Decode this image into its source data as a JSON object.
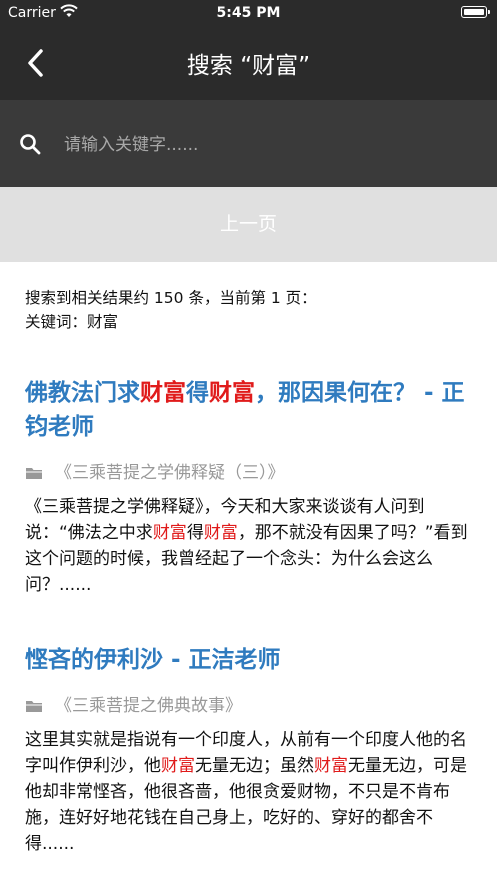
{
  "status": {
    "carrier": "Carrier",
    "time": "5:45 PM"
  },
  "nav": {
    "title": "搜索 “财富”"
  },
  "search": {
    "placeholder": "请输入关键字......"
  },
  "pager": {
    "prev_label": "上一页"
  },
  "summary": {
    "line1": "搜索到相关结果约 150 条，当前第 1 页：",
    "line2": "关键词：财富"
  },
  "keyword": "财富",
  "colors": {
    "accent": "#2f7bbf",
    "highlight": "#e01b1b",
    "bar": "#2b2b2b"
  },
  "results": [
    {
      "title_parts": [
        "佛教法门求",
        "财富",
        "得",
        "财富",
        "，那因果何在？ - 正钧老师"
      ],
      "source": "《三乘菩提之学佛释疑（三）》",
      "snippet_parts": [
        "《三乘菩提之学佛释疑》，今天和大家来谈谈有人问到说：“佛法之中求",
        "财富",
        "得",
        "财富",
        "，那不就没有因果了吗？”看到这个问题的时候，我曾经起了一个念头：为什么会这么问？......"
      ]
    },
    {
      "title_parts": [
        "悭吝的伊利沙 - 正洁老师"
      ],
      "source": "《三乘菩提之佛典故事》",
      "snippet_parts": [
        "这里其实就是指说有一个印度人，从前有一个印度人他的名字叫作伊利沙，他",
        "财富",
        "无量无边；虽然",
        "财富",
        "无量无边，可是他却非常悭吝，他很吝啬，他很贪爱财物，不只是不肯布施，连好好地花钱在自己身上，吃好的、穿好的都舍不得......"
      ]
    }
  ]
}
